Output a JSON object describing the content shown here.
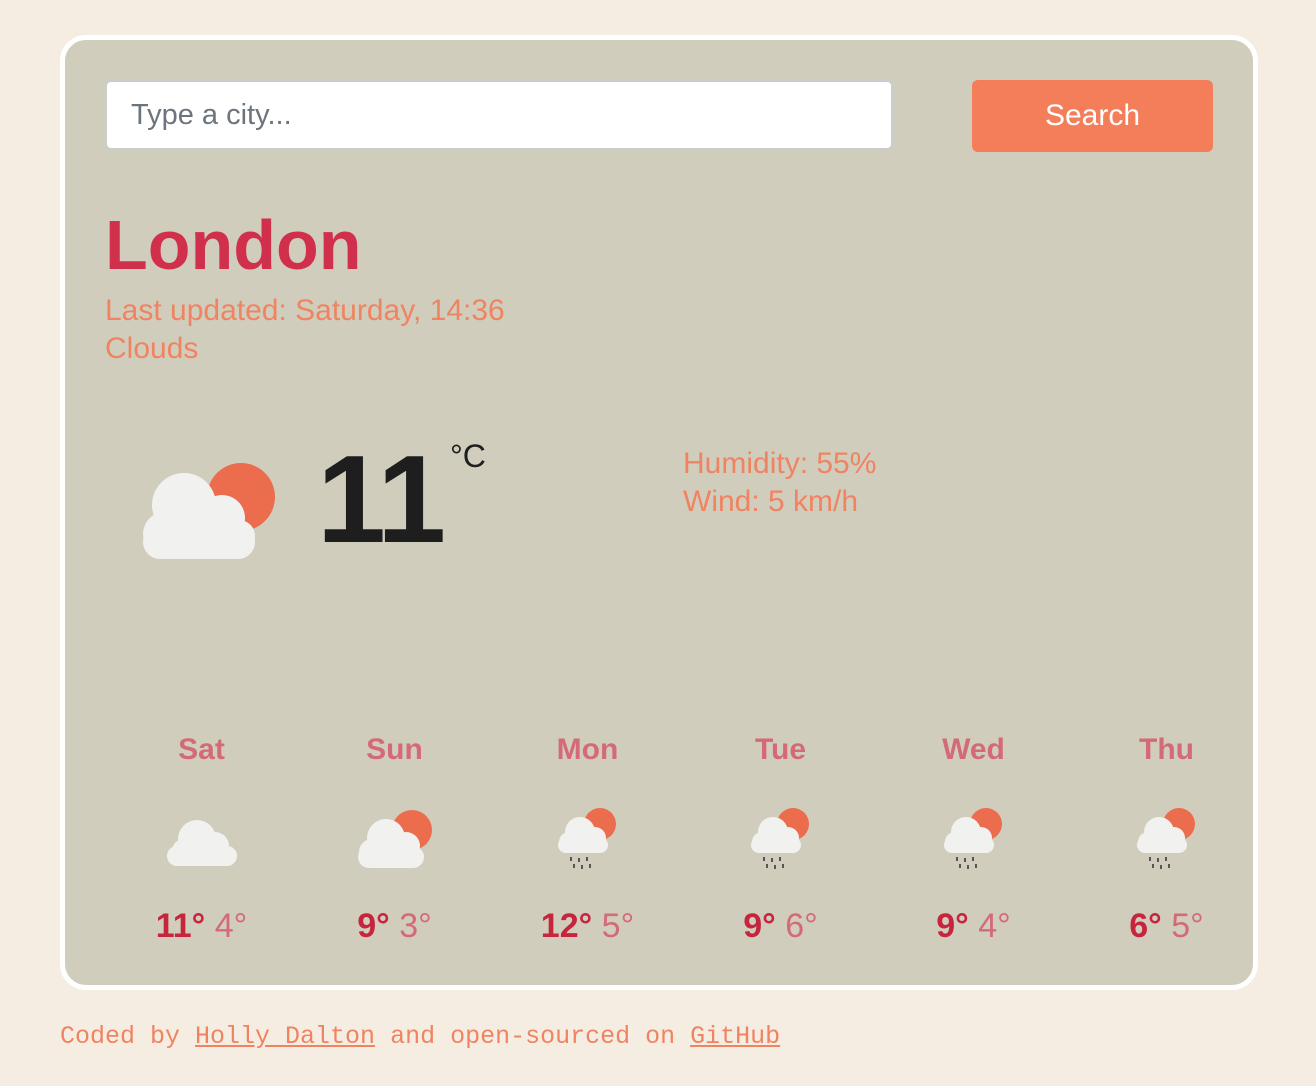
{
  "search": {
    "placeholder": "Type a city...",
    "button_label": "Search"
  },
  "current": {
    "city": "London",
    "last_updated": "Last updated: Saturday, 14:36",
    "description": "Clouds",
    "temperature": "11",
    "unit": "°C",
    "humidity": "Humidity: 55%",
    "wind": "Wind: 5 km/h",
    "icon": "partly-cloudy-icon"
  },
  "forecast": [
    {
      "day": "Sat",
      "max": "11°",
      "min": "4°",
      "icon": "cloud-icon"
    },
    {
      "day": "Sun",
      "max": "9°",
      "min": "3°",
      "icon": "partly-cloudy-icon"
    },
    {
      "day": "Mon",
      "max": "12°",
      "min": "5°",
      "icon": "rain-sun-icon"
    },
    {
      "day": "Tue",
      "max": "9°",
      "min": "6°",
      "icon": "rain-sun-icon"
    },
    {
      "day": "Wed",
      "max": "9°",
      "min": "4°",
      "icon": "rain-sun-icon"
    },
    {
      "day": "Thu",
      "max": "6°",
      "min": "5°",
      "icon": "rain-sun-icon"
    }
  ],
  "footer": {
    "prefix": "Coded by ",
    "author": "Holly Dalton",
    "middle": " and open-sourced on ",
    "repo": "GitHub"
  },
  "colors": {
    "accent": "#f47e5a",
    "city": "#d0304c",
    "card": "#d1cdbc",
    "page": "#f5ede1"
  }
}
